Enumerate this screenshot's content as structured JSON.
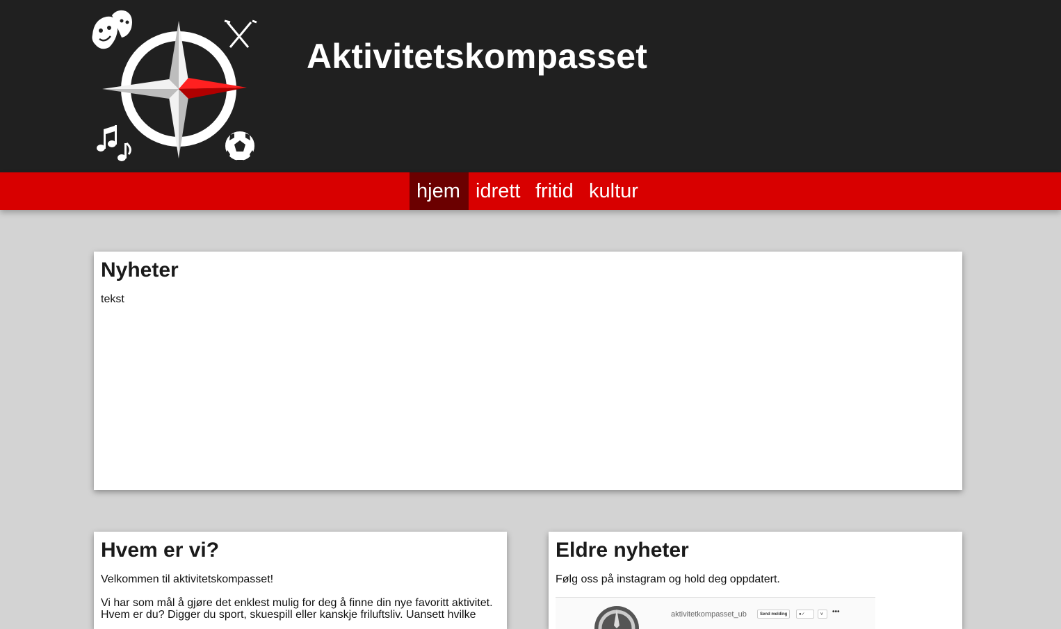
{
  "header": {
    "site_title": "Aktivitetskompasset"
  },
  "nav": {
    "items": [
      {
        "label": "hjem",
        "active": true
      },
      {
        "label": "idrett",
        "active": false
      },
      {
        "label": "fritid",
        "active": false
      },
      {
        "label": "kultur",
        "active": false
      }
    ]
  },
  "news": {
    "title": "Nyheter",
    "body": "tekst"
  },
  "about": {
    "title": "Hvem er vi?",
    "welcome": "Velkommen til aktivitetskompasset!",
    "intro": "Vi har som mål å gjøre det enklest mulig for deg å finne din nye favoritt aktivitet. Hvem er du? Digger du sport, skuespill eller kanskje friluftsliv. Uansett hvilke"
  },
  "older_news": {
    "title": "Eldre nyheter",
    "follow_text": "Følg oss på instagram og hold deg oppdatert.",
    "instagram": {
      "username": "aktivitetkompasset_ub",
      "message_button": "Send melding",
      "more": "•••"
    }
  },
  "colors": {
    "header_bg": "#202020",
    "nav_bg": "#d80000",
    "nav_active_bg": "#6b0000",
    "page_bg": "#d3d3d3",
    "accent_red": "#e00000"
  }
}
